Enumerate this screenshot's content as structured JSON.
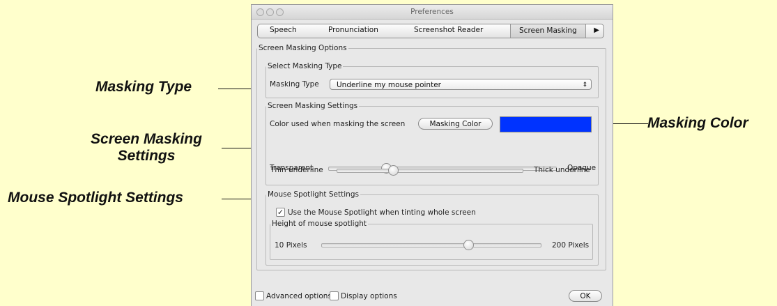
{
  "callouts": {
    "masking_type": "Masking Type",
    "screen_masking_settings_line1": "Screen Masking",
    "screen_masking_settings_line2": "Settings",
    "mouse_spotlight_settings": "Mouse Spotlight Settings",
    "masking_color": "Masking Color"
  },
  "window": {
    "title": "Preferences",
    "tabs": [
      "Speech",
      "Pronunciation",
      "Screenshot Reader",
      "Screen Masking"
    ],
    "active_tab": "Screen Masking"
  },
  "options": {
    "group_title": "Screen Masking Options",
    "select_type": {
      "group_title": "Select Masking Type",
      "label": "Masking Type",
      "value": "Underline my mouse pointer"
    },
    "settings": {
      "group_title": "Screen Masking Settings",
      "color_label": "Color used when masking the screen",
      "color_button": "Masking Color",
      "masking_color": "#0033ff",
      "transparency": {
        "min_label": "Transparent",
        "max_label": "Opaque",
        "value": 0.25
      },
      "underline": {
        "min_label": "Thin underline",
        "max_label": "Thick underline",
        "value": 0.3
      }
    },
    "spotlight": {
      "group_title": "Mouse Spotlight Settings",
      "checkbox_label": "Use the Mouse Spotlight when tinting whole screen",
      "checkbox_checked": true,
      "height_group_title": "Height of mouse spotlight",
      "min_label": "10 Pixels",
      "max_label": "200 Pixels",
      "value": 0.67
    }
  },
  "footer": {
    "advanced_label": "Advanced options",
    "advanced_checked": false,
    "display_label": "Display options",
    "display_checked": false,
    "ok_label": "OK"
  }
}
